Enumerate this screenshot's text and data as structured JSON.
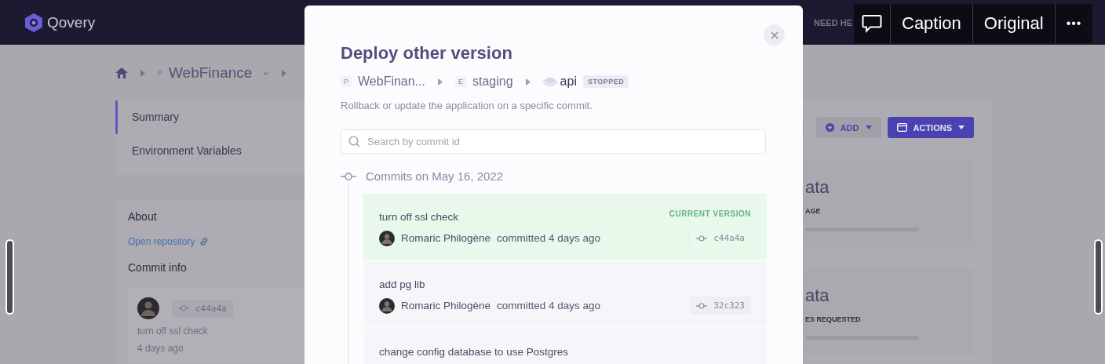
{
  "topbar": {
    "logo": "Qovery",
    "help": "NEED HE"
  },
  "breadcrumb": {
    "project_tag": "P",
    "project": "WebFinance"
  },
  "sidebar": {
    "items": [
      {
        "label": "Summary",
        "selected": true
      },
      {
        "label": "Environment Variables",
        "selected": false
      }
    ]
  },
  "about": {
    "title": "About",
    "link": "Open repository",
    "commit_title": "Commit info",
    "commit": {
      "hash": "c44a4a",
      "message": "turn off ssl check",
      "time": "4 days ago"
    }
  },
  "actions": [
    {
      "label": "ADD",
      "kind": "secondary"
    },
    {
      "label": "ACTIONS",
      "kind": "primary"
    }
  ],
  "cards": [
    {
      "title": "ata",
      "caption": "AGE"
    },
    {
      "title": "ata",
      "caption": "ES REQUESTED"
    }
  ],
  "modal": {
    "title": "Deploy other version",
    "path": [
      {
        "tag": "P",
        "label": "WebFinan...",
        "kind": "project"
      },
      {
        "tag": "E",
        "label": "staging",
        "kind": "environment"
      },
      {
        "label": "api",
        "kind": "application",
        "status": "STOPPED"
      }
    ],
    "description": "Rollback or update the application on a specific commit.",
    "search": {
      "placeholder": "Search by commit id"
    },
    "group": "Commits on May 16, 2022",
    "commits": [
      {
        "message": "turn off ssl check",
        "author": "Romaric Philogène",
        "time": "committed 4 days ago",
        "hash": "c44a4a",
        "current": true,
        "badge": "CURRENT VERSION"
      },
      {
        "message": "add pg lib",
        "author": "Romaric Philogène",
        "time": "committed 4 days ago",
        "hash": "32c323",
        "current": false
      },
      {
        "message": "change config database to use Postgres",
        "current": false
      }
    ]
  },
  "player": {
    "caption": "Caption",
    "original": "Original",
    "more": "•••"
  }
}
